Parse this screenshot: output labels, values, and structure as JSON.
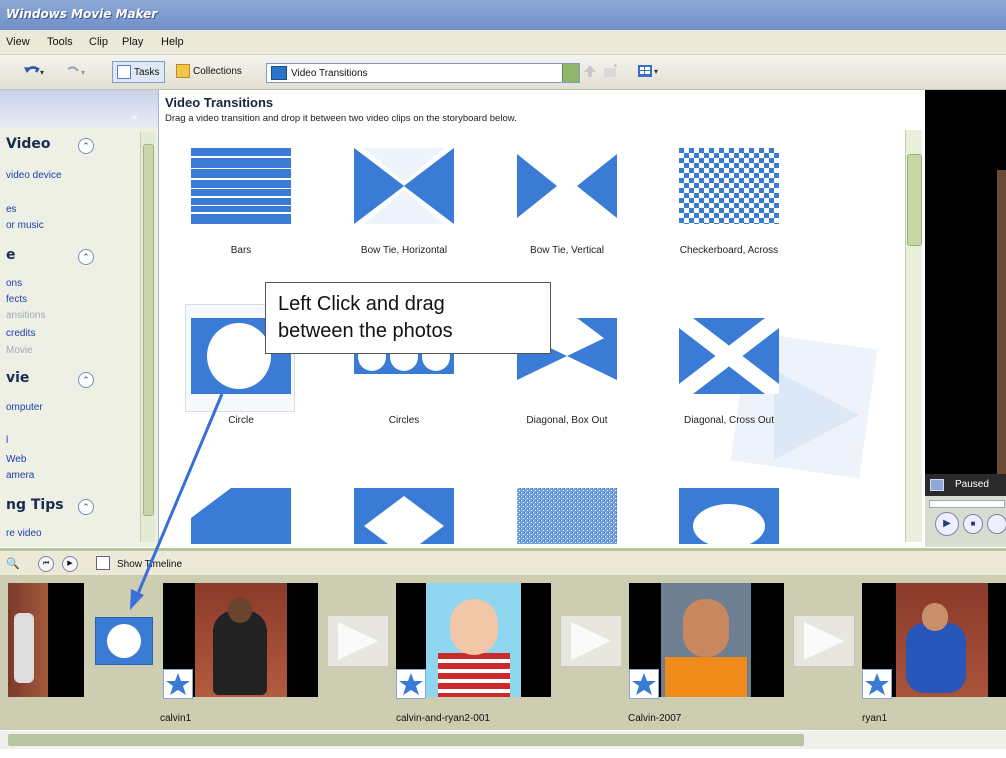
{
  "window": {
    "title": "Windows Movie Maker"
  },
  "menu": [
    "View",
    "Tools",
    "Clip",
    "Play",
    "Help"
  ],
  "toolbar": {
    "tasks_label": "Tasks",
    "collections_label": "Collections",
    "combo_value": "Video Transitions"
  },
  "taskpane": {
    "sections": [
      {
        "title": "Video",
        "links": [
          {
            "text": "video device",
            "disabled": false
          },
          {
            "text": "es",
            "disabled": false
          },
          {
            "text": "or music",
            "disabled": false
          }
        ]
      },
      {
        "title": "e",
        "links": [
          {
            "text": "ons",
            "disabled": false
          },
          {
            "text": "fects",
            "disabled": false
          },
          {
            "text": "ansitions",
            "disabled": true
          },
          {
            "text": "credits",
            "disabled": false
          },
          {
            "text": "Movie",
            "disabled": true
          }
        ]
      },
      {
        "title": "vie",
        "links": [
          {
            "text": "omputer",
            "disabled": false
          },
          {
            "text": "l",
            "disabled": false
          },
          {
            "text": "Web",
            "disabled": false
          },
          {
            "text": "amera",
            "disabled": false
          }
        ]
      },
      {
        "title": "ng Tips",
        "links": [
          {
            "text": "re video",
            "disabled": false
          }
        ]
      }
    ]
  },
  "content": {
    "title": "Video Transitions",
    "subtitle": "Drag a video transition and drop it between two video clips on the storyboard below.",
    "transitions": [
      "Bars",
      "Bow Tie, Horizontal",
      "Bow Tie, Vertical",
      "Checkerboard, Across",
      "Circle",
      "Circles",
      "Diagonal, Box Out",
      "Diagonal, Cross Out"
    ]
  },
  "preview": {
    "status": "Paused"
  },
  "storyboard": {
    "show_timeline_label": "Show Timeline",
    "clips": [
      "calvin1",
      "calvin-and-ryan2-001",
      "Calvin-2007",
      "ryan1"
    ]
  },
  "callout": {
    "line1": "Left Click and drag",
    "line2": "between the photos"
  },
  "colors": {
    "accent": "#3a6fd8",
    "transition_blue": "#3a7bd5",
    "storyboard_bg": "#cdcdb2"
  }
}
